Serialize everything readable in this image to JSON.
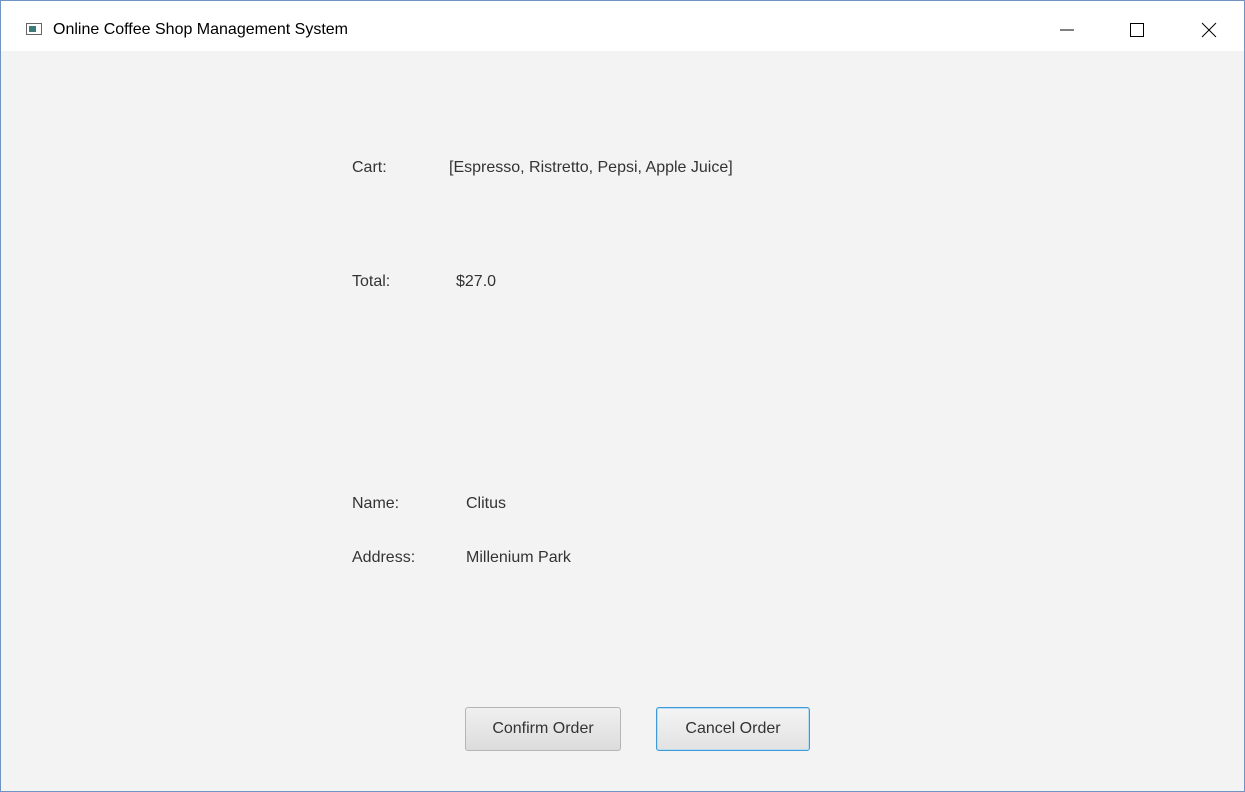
{
  "window": {
    "title": "Online Coffee Shop Management System"
  },
  "order": {
    "cart_label": "Cart:",
    "cart_value": "[Espresso, Ristretto, Pepsi, Apple Juice]",
    "total_label": "Total:",
    "total_value": "$27.0",
    "name_label": "Name:",
    "name_value": "Clitus",
    "address_label": "Address:",
    "address_value": "Millenium Park"
  },
  "buttons": {
    "confirm_label": "Confirm Order",
    "cancel_label": "Cancel Order"
  },
  "icons": {
    "app": "app-window-icon",
    "minimize": "minimize-icon",
    "maximize": "maximize-icon",
    "close": "close-icon"
  },
  "colors": {
    "focus_border": "#3e9ad6",
    "background": "#f3f3f3"
  }
}
